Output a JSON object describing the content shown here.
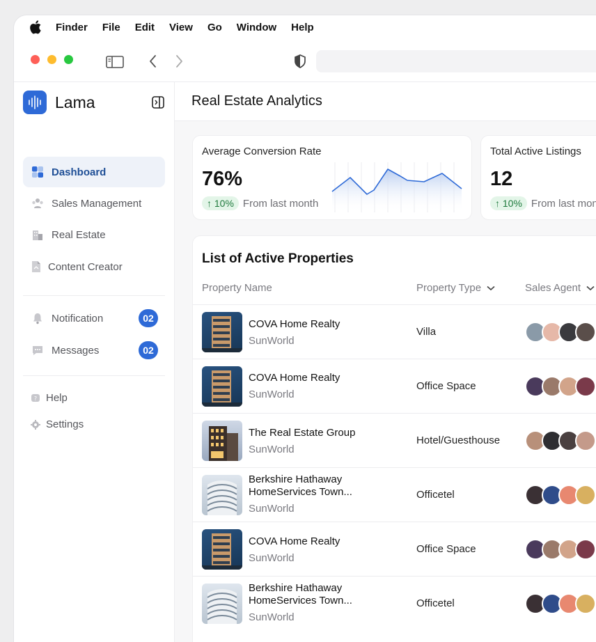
{
  "menubar": {
    "apple_icon": "apple-icon",
    "items": [
      "Finder",
      "File",
      "Edit",
      "View",
      "Go",
      "Window",
      "Help"
    ]
  },
  "toolbar": {
    "icons": [
      "sidebar-toggle-icon",
      "chevron-left-icon",
      "chevron-right-icon",
      "shield-icon"
    ]
  },
  "sidebar": {
    "brand": "Lama",
    "nav": [
      {
        "label": "Dashboard",
        "icon": "dashboard-icon",
        "active": true
      },
      {
        "label": "Sales Management",
        "icon": "users-icon"
      },
      {
        "label": "Real Estate",
        "icon": "building-icon"
      },
      {
        "label": "Content Creator",
        "icon": "document-icon"
      }
    ],
    "notifications": {
      "label": "Notification",
      "icon": "bell-icon",
      "badge": "02"
    },
    "messages": {
      "label": "Messages",
      "icon": "chat-icon",
      "badge": "02"
    },
    "help": {
      "label": "Help",
      "icon": "help-icon"
    },
    "settings": {
      "label": "Settings",
      "icon": "gear-icon"
    }
  },
  "main": {
    "title": "Real Estate Analytics",
    "stats": [
      {
        "title": "Average Conversion Rate",
        "value": "76%",
        "change": "↑ 10%",
        "change_text": "From last month"
      },
      {
        "title": "Total Active Listings",
        "value": "12",
        "change": "↑ 10%",
        "change_text": "From last month"
      }
    ],
    "list": {
      "title": "List of Active Properties",
      "columns": [
        "Property Name",
        "Property Type",
        "Sales Agent"
      ],
      "rows": [
        {
          "name": "COVA Home Realty",
          "company": "SunWorld",
          "type": "Villa",
          "thumb": "tower"
        },
        {
          "name": "COVA Home Realty",
          "company": "SunWorld",
          "type": "Office Space",
          "thumb": "tower"
        },
        {
          "name": "The Real Estate Group",
          "company": "SunWorld",
          "type": "Hotel/Guesthouse",
          "thumb": "block"
        },
        {
          "name": "Berkshire Hathaway HomeServices Town...",
          "company": "SunWorld",
          "type": "Officetel",
          "thumb": "curve"
        },
        {
          "name": "COVA Home Realty",
          "company": "SunWorld",
          "type": "Office Space",
          "thumb": "tower"
        },
        {
          "name": "Berkshire Hathaway HomeServices Town...",
          "company": "SunWorld",
          "type": "Officetel",
          "thumb": "curve"
        }
      ]
    }
  },
  "colors": {
    "accent": "#2e6ad7",
    "positive_bg": "#e3f5e8",
    "positive_text": "#1f7a3d"
  }
}
